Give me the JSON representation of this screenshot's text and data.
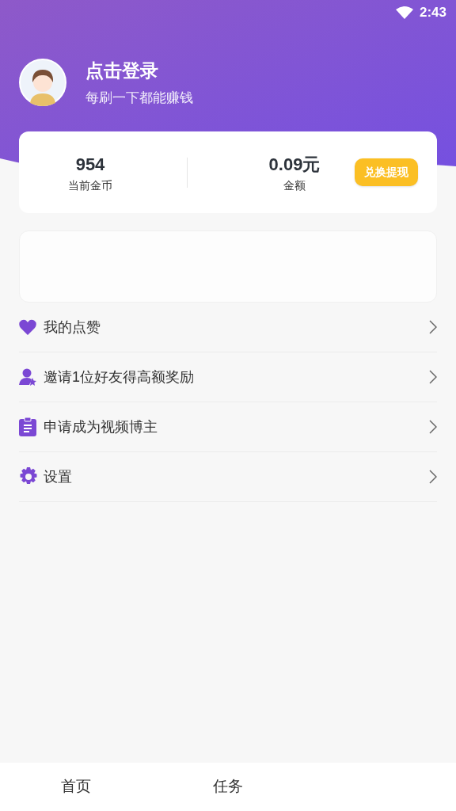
{
  "status_bar": {
    "time": "2:43"
  },
  "profile": {
    "title": "点击登录",
    "subtitle": "每刷一下都能赚钱"
  },
  "wallet": {
    "coins": "954",
    "coins_label": "当前金币",
    "amount": "0.09元",
    "amount_label": "金额",
    "button": "兑换提现"
  },
  "menu": [
    {
      "kind": "heart",
      "label": "我的点赞"
    },
    {
      "kind": "invite",
      "label": "邀请1位好友得高额奖励"
    },
    {
      "kind": "clipboard",
      "label": "申请成为视频博主"
    },
    {
      "kind": "gear",
      "label": "设置"
    }
  ],
  "tabs": [
    {
      "label": "首页"
    },
    {
      "label": "任务"
    }
  ]
}
